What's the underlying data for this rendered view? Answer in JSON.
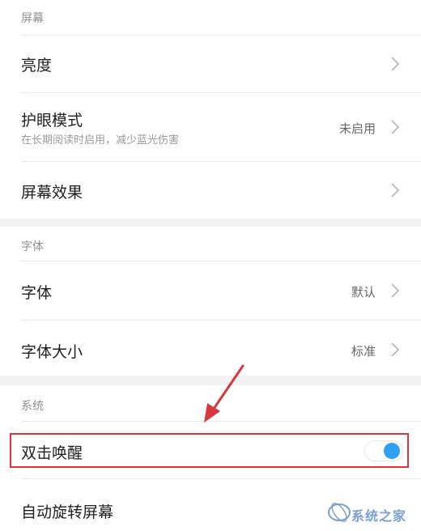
{
  "sections": {
    "screen": {
      "title": "屏幕",
      "brightness": {
        "label": "亮度"
      },
      "eye_mode": {
        "label": "护眼模式",
        "subtitle": "在长期阅读时启用，减少蓝光伤害",
        "value": "未启用"
      },
      "screen_effect": {
        "label": "屏幕效果"
      }
    },
    "font": {
      "title": "字体",
      "font_face": {
        "label": "字体",
        "value": "默认"
      },
      "font_size": {
        "label": "字体大小",
        "value": "标准"
      }
    },
    "system": {
      "title": "系统",
      "double_tap_wake": {
        "label": "双击唤醒",
        "toggle_on": true
      },
      "auto_rotate": {
        "label": "自动旋转屏幕"
      }
    }
  },
  "watermark": {
    "text": "系统之家"
  },
  "colors": {
    "toggle_on": "#2ea1f2",
    "highlight": "#d9363e",
    "section_gap": "#f2f2f2"
  },
  "icons": {
    "chevron": "chevron-right-icon",
    "arrow": "red-annotation-arrow",
    "watermark_logo": "watermark-logo-icon"
  }
}
